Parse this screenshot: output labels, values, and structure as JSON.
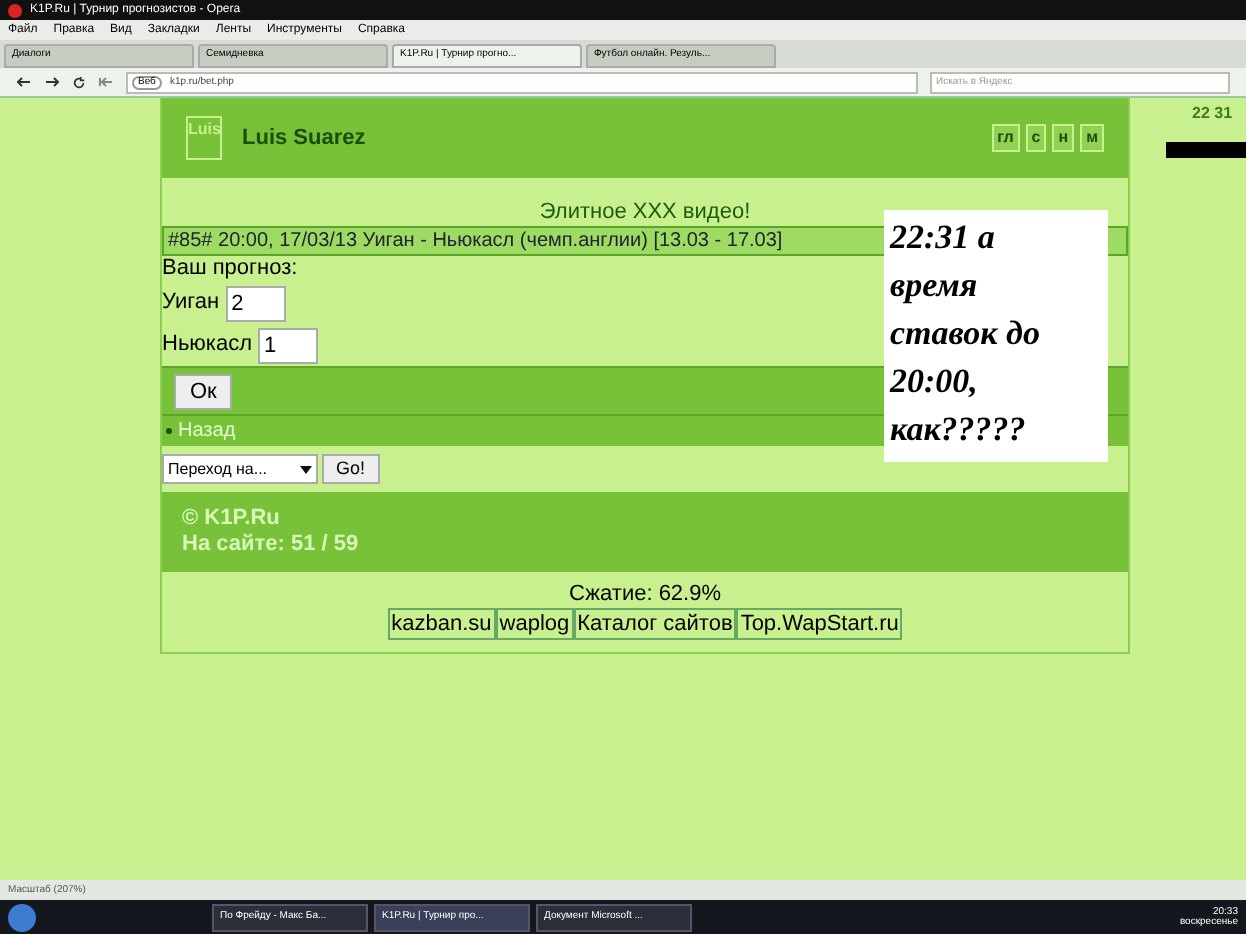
{
  "window": {
    "title": "K1P.Ru | Турнир прогнозистов - Opera"
  },
  "menu": [
    "Файл",
    "Правка",
    "Вид",
    "Закладки",
    "Ленты",
    "Инструменты",
    "Справка"
  ],
  "tabs": [
    {
      "label": "Диалоги",
      "selected": false
    },
    {
      "label": "Семидневка",
      "selected": false
    },
    {
      "label": "K1P.Ru | Турнир прогно...",
      "selected": true
    },
    {
      "label": "Футбол онлайн. Резуль...",
      "selected": false
    }
  ],
  "address_bar": {
    "badge": "Веб",
    "url": "k1p.ru/bet.php",
    "search_placeholder": "Искать в Яндекс"
  },
  "page": {
    "header": {
      "avatar_text": "Luis",
      "username": "Luis Suarez",
      "nav_links": [
        "гл",
        "с",
        "н",
        "м"
      ]
    },
    "ad_link": "Элитное XXX видео!",
    "match": "#85# 20:00, 17/03/13 Уиган - Ньюкасл (чемп.англии) [13.03 - 17.03]",
    "prompt": "Ваш прогноз:",
    "teams": [
      {
        "name": "Уиган",
        "value": "2"
      },
      {
        "name": "Ньюкасл",
        "value": "1"
      }
    ],
    "submit": "Ок",
    "back_link": "Назад",
    "jump_select": "Переход на...",
    "go_button": "Go!",
    "footer": {
      "copyright": "© K1P.Ru",
      "online": "На сайте: 51 / 59"
    },
    "compression": "Сжатие: 62.9%",
    "counters": [
      "kazban.su",
      "waplog",
      "Каталог сайтов",
      "Top.WapStart.ru"
    ],
    "corner_time": "22 31"
  },
  "annotation": "22:31 а время ставок до 20:00, как?????",
  "status_bar": {
    "zoom": "Масштаб (207%)"
  },
  "taskbar": {
    "items": [
      {
        "label": "По Фрейду - Макс Ба...",
        "selected": false
      },
      {
        "label": "K1P.Ru | Турнир про...",
        "selected": true
      },
      {
        "label": "Документ Microsoft ...",
        "selected": false
      }
    ],
    "time": "20:33",
    "day": "воскресенье"
  }
}
